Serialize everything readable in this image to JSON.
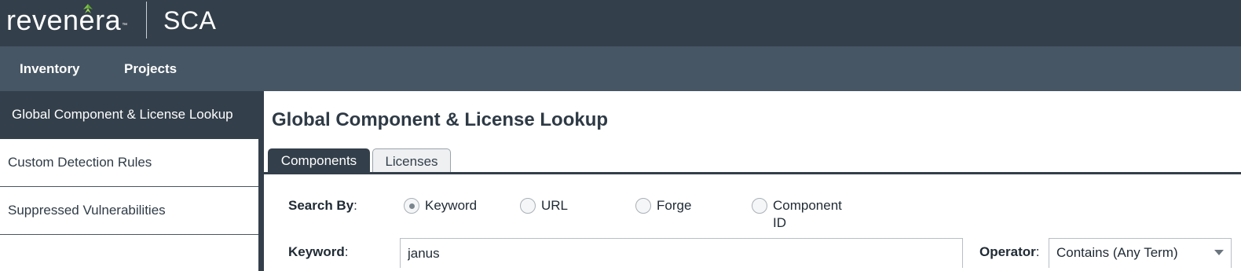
{
  "header": {
    "logo_text": "revenera",
    "logo_tm": "™",
    "product_name": "SCA",
    "logo_leaf_color": "#7ac143"
  },
  "nav": {
    "items": [
      {
        "label": "Inventory"
      },
      {
        "label": "Projects"
      }
    ]
  },
  "sidebar": {
    "items": [
      {
        "label": "Global Component & License Lookup",
        "active": true
      },
      {
        "label": "Custom Detection Rules",
        "active": false
      },
      {
        "label": "Suppressed Vulnerabilities",
        "active": false
      }
    ]
  },
  "main": {
    "title": "Global Component & License Lookup",
    "tabs": [
      {
        "label": "Components",
        "active": true
      },
      {
        "label": "Licenses",
        "active": false
      }
    ],
    "search_by": {
      "label": "Search By",
      "colon": ":",
      "options": [
        {
          "label": "Keyword",
          "selected": true
        },
        {
          "label": "URL",
          "selected": false
        },
        {
          "label": "Forge",
          "selected": false
        },
        {
          "label": "Component",
          "label_line2": "ID",
          "selected": false
        }
      ]
    },
    "keyword": {
      "label": "Keyword",
      "colon": ":",
      "value": "janus"
    },
    "operator": {
      "label": "Operator",
      "colon": ":",
      "value": "Contains (Any Term)"
    }
  },
  "colors": {
    "header_bg": "#333f4a",
    "nav_bg": "#465664",
    "active_bg": "#333f4a"
  }
}
